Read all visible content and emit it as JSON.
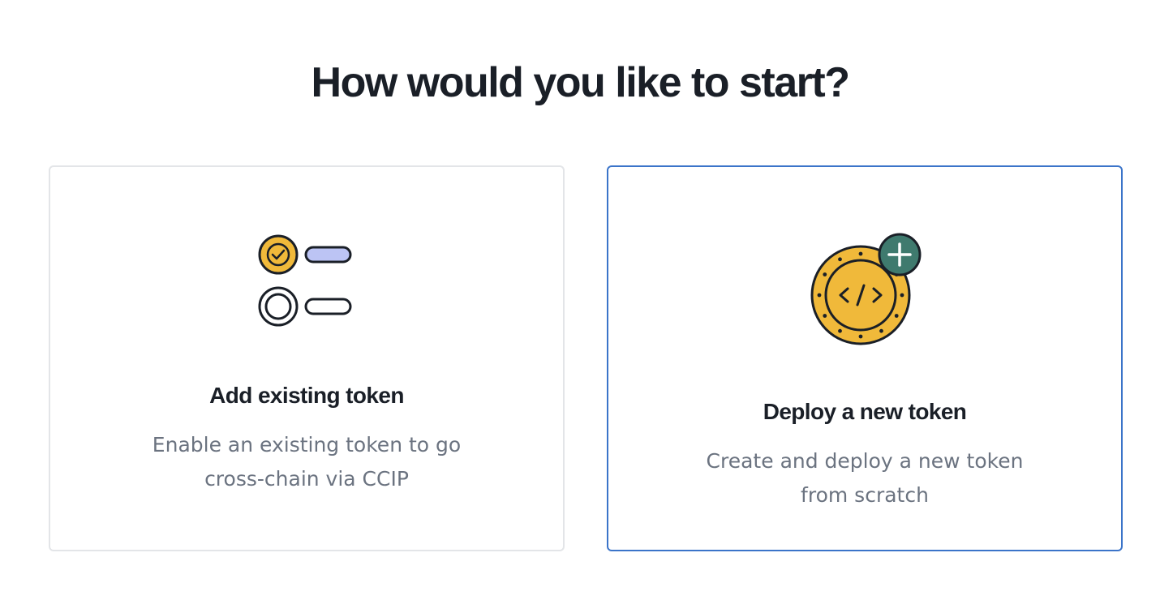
{
  "page": {
    "heading": "How would you like to start?"
  },
  "options": [
    {
      "title": "Add existing token",
      "description": "Enable an existing token to go cross-chain via CCIP",
      "icon": "token-list-icon",
      "selected": false
    },
    {
      "title": "Deploy a new token",
      "description": "Create and deploy a new token from scratch",
      "icon": "coin-code-plus-icon",
      "selected": true
    }
  ],
  "colors": {
    "heading_text": "#1a1f27",
    "description_text": "#6b7380",
    "card_border": "#e3e5e8",
    "selected_border": "#3b74c9",
    "coin_gold": "#f0b93a",
    "pill_lavender": "#bcc4f4",
    "plus_badge": "#3f7a6e"
  }
}
